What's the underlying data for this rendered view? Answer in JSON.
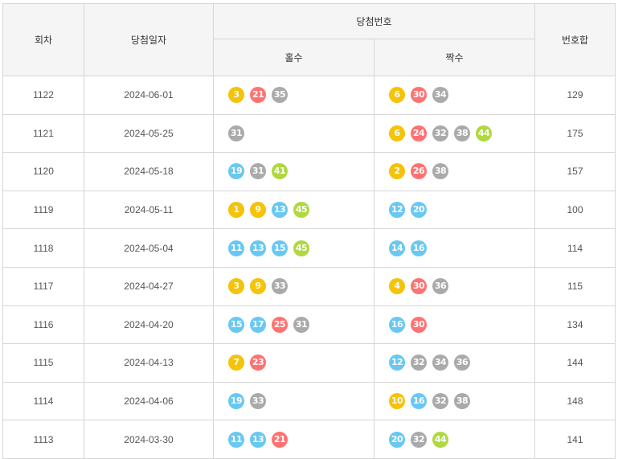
{
  "headers": {
    "round": "회차",
    "date": "당첨일자",
    "winning_numbers": "당첨번호",
    "odd": "홀수",
    "even": "짝수",
    "sum": "번호합"
  },
  "ball_colors": {
    "yellow": "#f4c30a",
    "blue": "#69c8f2",
    "red": "#ff7272",
    "gray": "#aaaaaa",
    "green": "#b0d840"
  },
  "rows": [
    {
      "round": "1122",
      "date": "2024-06-01",
      "odd": [
        3,
        21,
        35
      ],
      "even": [
        6,
        30,
        34
      ],
      "sum": "129"
    },
    {
      "round": "1121",
      "date": "2024-05-25",
      "odd": [
        31
      ],
      "even": [
        6,
        24,
        32,
        38,
        44
      ],
      "sum": "175"
    },
    {
      "round": "1120",
      "date": "2024-05-18",
      "odd": [
        19,
        31,
        41
      ],
      "even": [
        2,
        26,
        38
      ],
      "sum": "157"
    },
    {
      "round": "1119",
      "date": "2024-05-11",
      "odd": [
        1,
        9,
        13,
        45
      ],
      "even": [
        12,
        20
      ],
      "sum": "100"
    },
    {
      "round": "1118",
      "date": "2024-05-04",
      "odd": [
        11,
        13,
        15,
        45
      ],
      "even": [
        14,
        16
      ],
      "sum": "114"
    },
    {
      "round": "1117",
      "date": "2024-04-27",
      "odd": [
        3,
        9,
        33
      ],
      "even": [
        4,
        30,
        36
      ],
      "sum": "115"
    },
    {
      "round": "1116",
      "date": "2024-04-20",
      "odd": [
        15,
        17,
        25,
        31
      ],
      "even": [
        16,
        30
      ],
      "sum": "134"
    },
    {
      "round": "1115",
      "date": "2024-04-13",
      "odd": [
        7,
        23
      ],
      "even": [
        12,
        32,
        34,
        36
      ],
      "sum": "144"
    },
    {
      "round": "1114",
      "date": "2024-04-06",
      "odd": [
        19,
        33
      ],
      "even": [
        10,
        16,
        32,
        38
      ],
      "sum": "148"
    },
    {
      "round": "1113",
      "date": "2024-03-30",
      "odd": [
        11,
        13,
        21
      ],
      "even": [
        20,
        32,
        44
      ],
      "sum": "141"
    }
  ]
}
